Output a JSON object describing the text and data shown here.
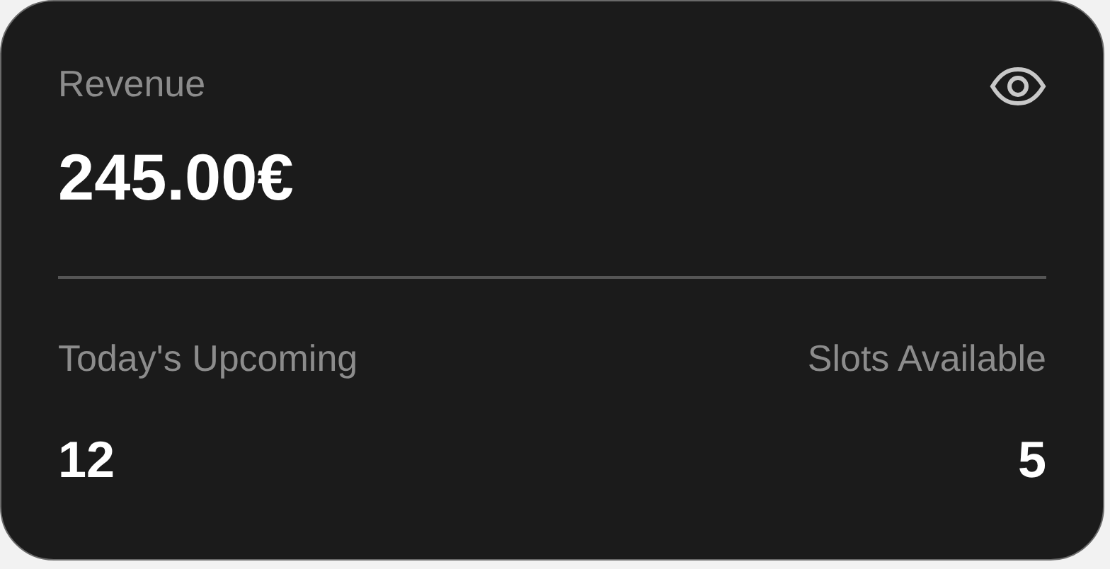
{
  "card": {
    "label": "Revenue",
    "value": "245.00€",
    "stats": [
      {
        "label": "Today's Upcoming",
        "value": "12"
      },
      {
        "label": "Slots Available",
        "value": "5"
      }
    ]
  }
}
